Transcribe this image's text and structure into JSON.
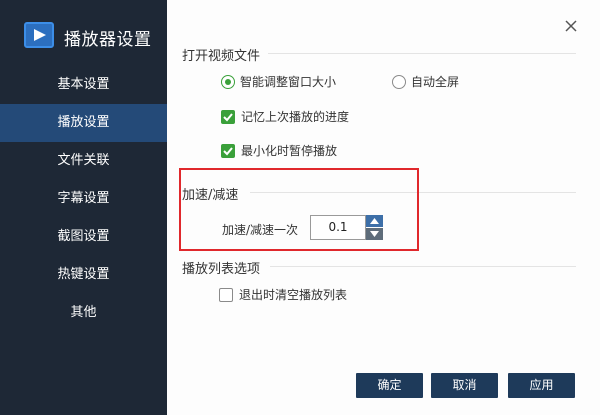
{
  "app": {
    "title": "播放器设置",
    "logo_icon": "video-player-icon"
  },
  "sidebar": {
    "items": [
      {
        "label": "基本设置",
        "active": false
      },
      {
        "label": "播放设置",
        "active": true
      },
      {
        "label": "文件关联",
        "active": false
      },
      {
        "label": "字幕设置",
        "active": false
      },
      {
        "label": "截图设置",
        "active": false
      },
      {
        "label": "热键设置",
        "active": false
      },
      {
        "label": "其他",
        "active": false
      }
    ]
  },
  "sections": {
    "open_video": {
      "title": "打开视频文件",
      "radio_smart": {
        "label": "智能调整窗口大小",
        "selected": true
      },
      "radio_fullscreen": {
        "label": "自动全屏",
        "selected": false
      },
      "check_remember": {
        "label": "记忆上次播放的进度",
        "checked": true
      },
      "check_pause": {
        "label": "最小化时暂停播放",
        "checked": true
      }
    },
    "speed": {
      "title": "加速/减速",
      "step_label": "加速/减速一次",
      "step_value": "0.1"
    },
    "playlist": {
      "title": "播放列表选项",
      "check_clear": {
        "label": "退出时清空播放列表",
        "checked": false
      }
    }
  },
  "buttons": {
    "ok": "确定",
    "cancel": "取消",
    "apply": "应用"
  },
  "colors": {
    "sidebar_bg": "#1e2836",
    "active_item": "#244a78",
    "accent_green": "#3aa03a",
    "highlight_red": "#e0282c",
    "button_bg": "#1e3a5a"
  }
}
